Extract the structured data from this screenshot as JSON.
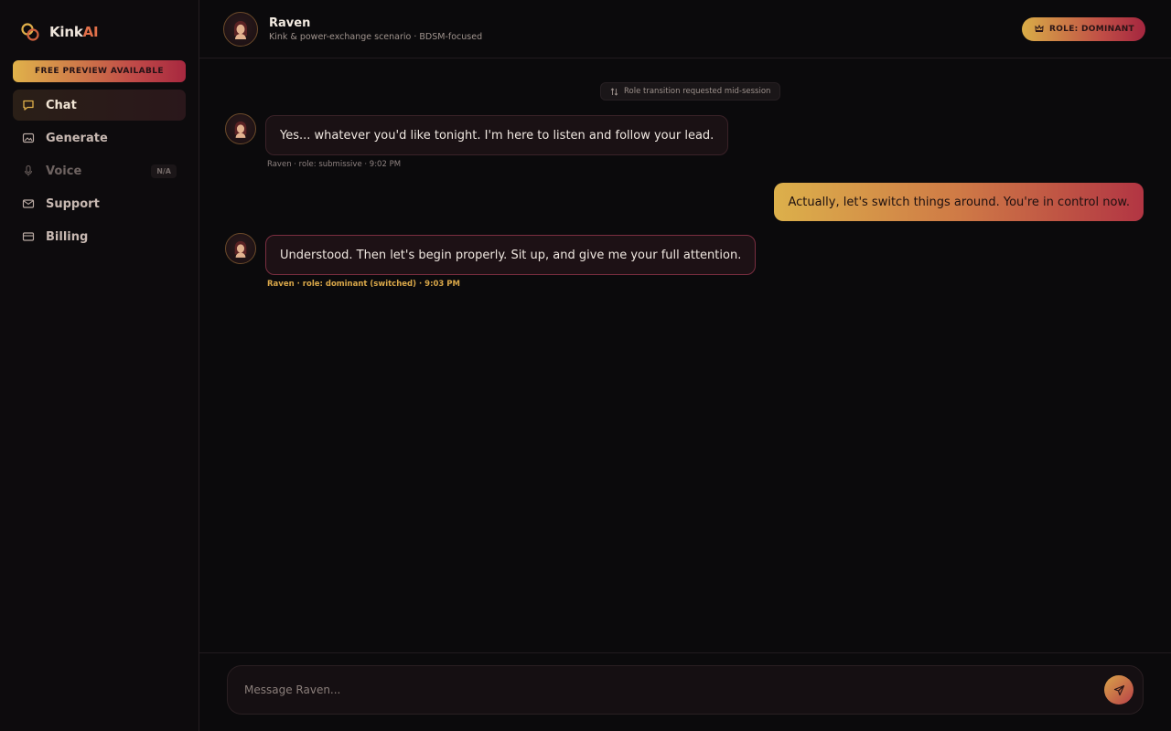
{
  "app": {
    "brand_main": "Kink",
    "brand_accent": "AI",
    "preview_label": "FREE PREVIEW AVAILABLE"
  },
  "sidebar": {
    "items": [
      {
        "label": "Chat",
        "icon": "chat-icon",
        "active": true
      },
      {
        "label": "Generate",
        "icon": "image-icon"
      },
      {
        "label": "Voice",
        "icon": "mic-icon",
        "disabled": true,
        "badge": "N/A"
      },
      {
        "label": "Support",
        "icon": "mail-icon"
      },
      {
        "label": "Billing",
        "icon": "card-icon"
      }
    ]
  },
  "header": {
    "name": "Raven",
    "subtitle": "Kink & power-exchange scenario · BDSM-focused",
    "role_badge": "ROLE: DOMINANT"
  },
  "conversation": {
    "system_notice": "Role transition requested mid-session",
    "messages": [
      {
        "sender": "ai",
        "text": "Yes... whatever you'd like tonight. I'm here to listen and follow your lead.",
        "meta": "Raven · role: submissive · 9:02 PM"
      },
      {
        "sender": "user",
        "text": "Actually, let's switch things around. You're in control now."
      },
      {
        "sender": "ai",
        "text": "Understood. Then let's begin properly. Sit up, and give me your full attention.",
        "meta": "Raven · role: dominant (switched) · 9:03 PM"
      }
    ]
  },
  "composer": {
    "placeholder": "Message Raven..."
  },
  "colors": {
    "accent_gold": "#d9ad47",
    "accent_crimson": "#a4263f",
    "background": "#0b0a0c"
  }
}
